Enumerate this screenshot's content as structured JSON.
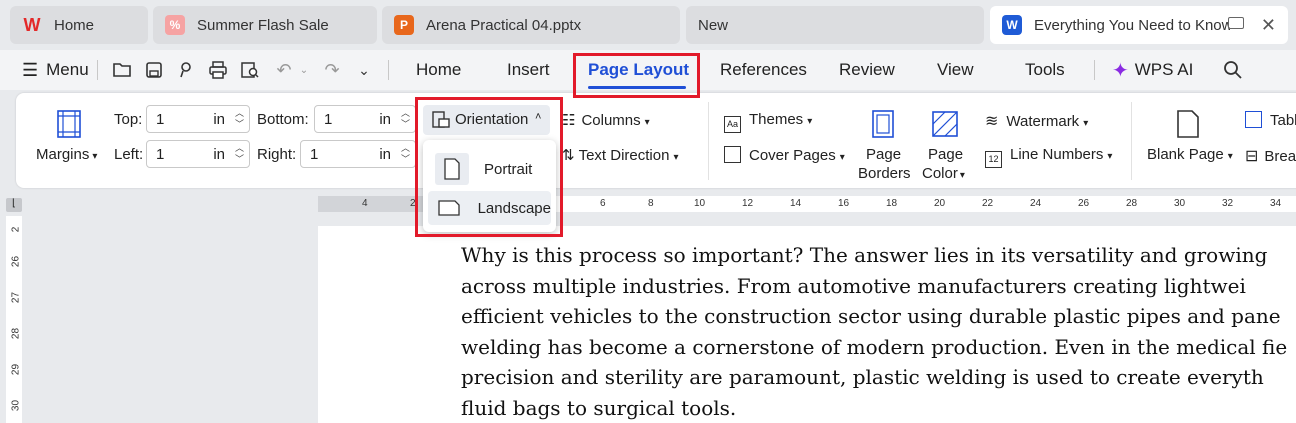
{
  "tabs": [
    {
      "label": "Home",
      "icon": "wps-logo-icon",
      "color": "#e32929"
    },
    {
      "label": "Summer Flash Sale",
      "icon": "sale-tag-icon",
      "color": "#f08080"
    },
    {
      "label": "Arena Practical 04.pptx",
      "icon": "presentation-icon",
      "color": "#e8671c"
    },
    {
      "label": "New",
      "icon": "",
      "color": ""
    },
    {
      "label": "Everything You Need to Know",
      "icon": "word-doc-icon",
      "color": "#1f5bd6"
    }
  ],
  "menubar": {
    "menu_label": "Menu",
    "tabs": [
      "Home",
      "Insert",
      "Page Layout",
      "References",
      "Review",
      "View",
      "Tools"
    ],
    "active_tab": "Page Layout",
    "wps_ai": "WPS AI"
  },
  "ribbon": {
    "margins": "Margins",
    "top_label": "Top:",
    "top_value": "1",
    "bottom_label": "Bottom:",
    "bottom_value": "1",
    "left_label": "Left:",
    "left_value": "1",
    "right_label": "Right:",
    "right_value": "1",
    "unit": "in",
    "orientation": "Orientation",
    "columns": "Columns",
    "text_direction": "Text Direction",
    "themes": "Themes",
    "cover_pages": "Cover Pages",
    "page_borders_1": "Page",
    "page_borders_2": "Borders",
    "page_color_1": "Page",
    "page_color_2": "Color",
    "watermark": "Watermark",
    "line_numbers": "Line Numbers",
    "blank_page": "Blank Page",
    "table_partial": "Tabl",
    "break_partial": "Brea"
  },
  "orientation_menu": {
    "items": [
      "Portrait",
      "Landscape"
    ],
    "hovered": "Landscape"
  },
  "ruler": {
    "h_numbers": [
      "4",
      "2",
      "6",
      "8",
      "10",
      "12",
      "14",
      "16",
      "18",
      "20",
      "22",
      "24",
      "26",
      "28",
      "30",
      "32",
      "34"
    ],
    "v_numbers": [
      "2",
      "26",
      "27",
      "28",
      "29",
      "30"
    ]
  },
  "document": {
    "lines": [
      "Why is this process so important? The answer lies in its versatility and growing",
      "across multiple industries. From automotive manufacturers creating lightwei",
      "efficient vehicles to the construction sector using durable plastic pipes and pane",
      "welding has become a cornerstone of modern production. Even in the medical fie",
      "precision and sterility are paramount, plastic welding is used to create everyth",
      "fluid bags to surgical tools."
    ]
  },
  "colors": {
    "accent": "#1f4fd6",
    "highlight_box": "#e21a2a"
  }
}
